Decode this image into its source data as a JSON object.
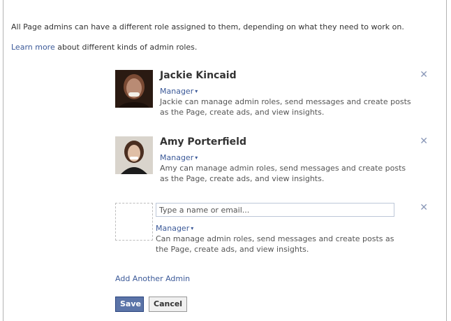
{
  "intro": {
    "line1": "All Page admins can have a different role assigned to them, depending on what they need to work on.",
    "learn_more": "Learn more",
    "line2_rest": " about different kinds of admin roles."
  },
  "admins": [
    {
      "name": "Jackie Kincaid",
      "role": "Manager",
      "description": "Jackie can manage admin roles, send messages and create posts as the Page, create ads, and view insights."
    },
    {
      "name": "Amy Porterfield",
      "role": "Manager",
      "description": "Amy can manage admin roles, send messages and create posts as the Page, create ads, and view insights."
    }
  ],
  "new_admin": {
    "placeholder": "Type a name or email...",
    "role": "Manager",
    "description": "Can manage admin roles, send messages and create posts as the Page, create ads, and view insights."
  },
  "remove_glyph": "✕",
  "role_caret": "▾",
  "add_another_label": "Add Another Admin",
  "buttons": {
    "save": "Save",
    "cancel": "Cancel"
  },
  "colors": {
    "link": "#3b5998",
    "save_bg": "#5b74a8",
    "remove": "#8a98b8"
  }
}
